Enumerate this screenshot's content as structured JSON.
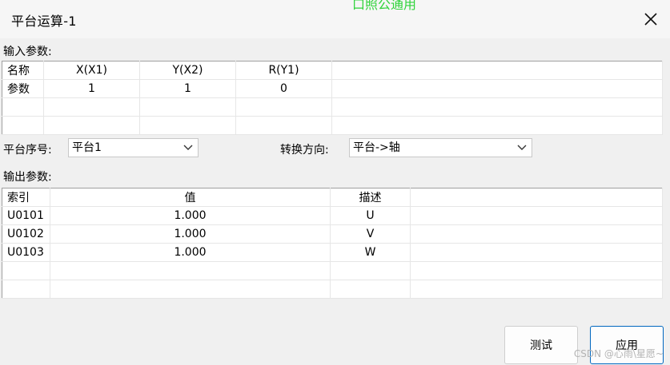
{
  "window": {
    "title": "平台运算-1",
    "background_text": "口照公通用"
  },
  "input_section": {
    "label": "输入参数:",
    "table": {
      "rows": [
        [
          "名称",
          "X(X1)",
          "Y(X2)",
          "R(Y1)",
          ""
        ],
        [
          "参数",
          "1",
          "1",
          "0",
          ""
        ],
        [
          "",
          "",
          "",
          "",
          ""
        ],
        [
          "",
          "",
          "",
          "",
          ""
        ]
      ]
    }
  },
  "platform": {
    "label": "平台序号:",
    "value": "平台1"
  },
  "direction": {
    "label": "转换方向:",
    "value": "平台->轴"
  },
  "output_section": {
    "label": "输出参数:",
    "table": {
      "rows": [
        [
          "索引",
          "值",
          "描述",
          ""
        ],
        [
          "U0101",
          "1.000",
          "U",
          ""
        ],
        [
          "U0102",
          "1.000",
          "V",
          ""
        ],
        [
          "U0103",
          "1.000",
          "W",
          ""
        ],
        [
          "",
          "",
          "",
          ""
        ],
        [
          "",
          "",
          "",
          ""
        ]
      ]
    }
  },
  "buttons": {
    "test": "测试",
    "apply": "应用"
  },
  "watermark": "CSDN @心雨\\星愿~"
}
